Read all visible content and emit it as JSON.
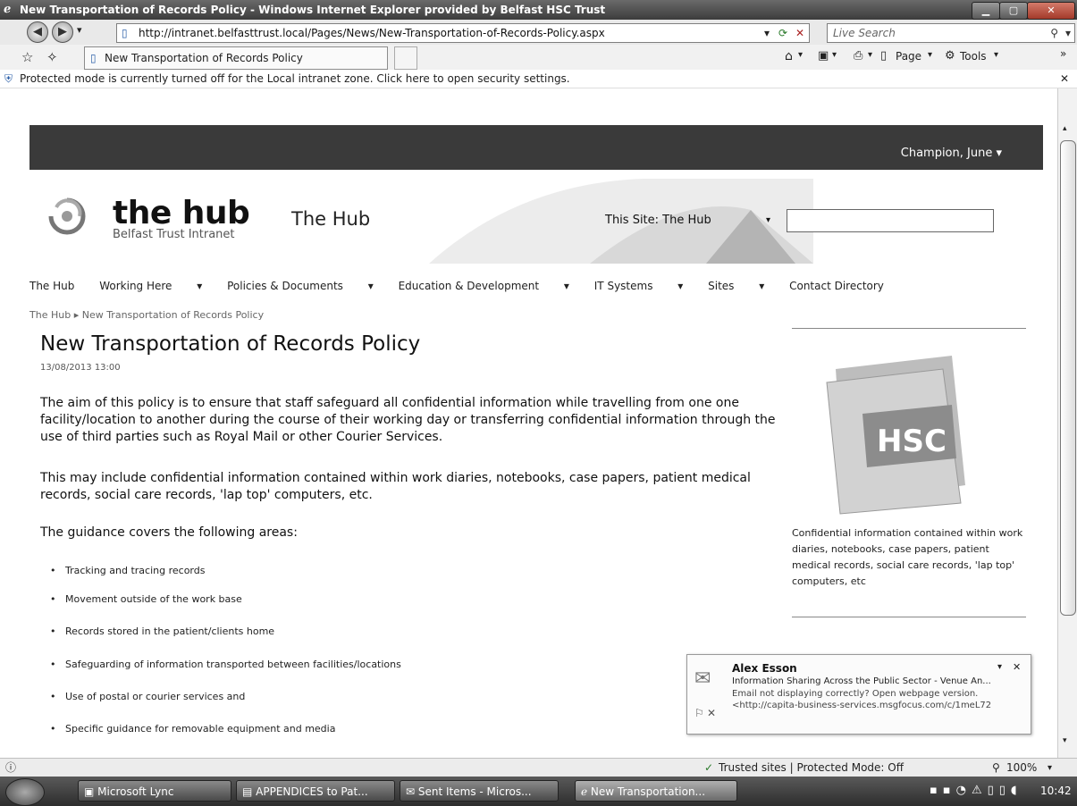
{
  "window": {
    "title": "New Transportation of Records Policy - Windows Internet Explorer provided by Belfast HSC Trust",
    "url": "http://intranet.belfasttrust.local/Pages/News/New-Transportation-of-Records-Policy.aspx",
    "search_placeholder": "Live Search",
    "tab_title": "New Transportation of Records Policy",
    "cmd_page": "Page",
    "cmd_tools": "Tools",
    "infobar_text": "Protected mode is currently turned off for the Local intranet zone. Click here to open security settings."
  },
  "site": {
    "user": "Champion, June",
    "logo_main": "the hub",
    "logo_sub": "Belfast Trust Intranet",
    "site_title": "The Hub",
    "search_scope": "This Site: The Hub",
    "nav": [
      "The Hub",
      "Working Here",
      "Policies & Documents",
      "Education & Development",
      "IT Systems",
      "Sites",
      "Contact Directory"
    ],
    "breadcrumb": [
      "The Hub",
      "New Transportation of Records Policy"
    ]
  },
  "article": {
    "title": "New Transportation of Records Policy",
    "date": "13/08/2013 13:00",
    "para1": "The aim of this policy is to ensure that staff safeguard all confidential information while travelling from one one facility/location to another during the course of their working day or transferring confidential information through the use of third parties such as Royal Mail or other Courier Services.",
    "para2": "This may include confidential information contained within work diaries, notebooks, case papers, patient medical records, social care records, 'lap top' computers, etc.",
    "para3": "The guidance covers the following areas:",
    "bullets": [
      "Tracking and tracing records",
      "Movement outside of the work base",
      "Records stored in the patient/clients home",
      "Safeguarding of information transported between facilities/locations",
      "Use of postal or courier services and",
      "Specific guidance for removable equipment and media"
    ],
    "image_caption": "Confidential information contained within work diaries, notebooks, case papers, patient medical records, social care records, 'lap top' computers, etc",
    "image_label": "HSC"
  },
  "notification": {
    "sender": "Alex Esson",
    "subject": "Information Sharing Across the Public Sector - Venue An...",
    "line3": "Email not displaying correctly? Open webpage version.",
    "line4": "<http://capita-business-services.msgfocus.com/c/1meL72"
  },
  "status": {
    "zone": "Trusted sites | Protected Mode: Off",
    "zoom": "100%"
  },
  "taskbar": {
    "items": [
      "Microsoft Lync",
      "APPENDICES to Pat...",
      "Sent Items - Micros...",
      "New Transportation..."
    ],
    "clock": "10:42"
  }
}
